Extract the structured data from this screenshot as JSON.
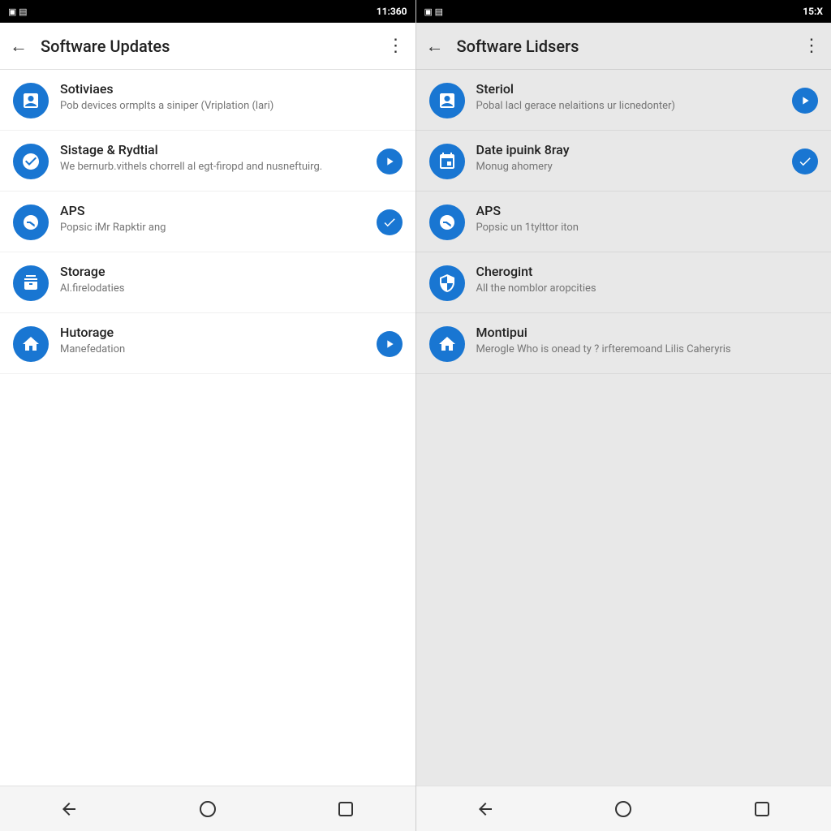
{
  "left_panel": {
    "status_bar": {
      "left_icons": "▣ ▤",
      "time": "11:360",
      "right_icons": "✦ ⊞ ▾ ▴ ▌▌"
    },
    "app_bar": {
      "title": "Software Updates",
      "back_icon": "←",
      "more_icon": "⋮"
    },
    "items": [
      {
        "id": "sotiviaes",
        "title": "Sotiviaes",
        "subtitle": "Pob devices ormplts a siniper (Vriplation (lari)",
        "has_action": false,
        "action_type": ""
      },
      {
        "id": "sistage-rydtial",
        "title": "Sistage & Rydtial",
        "subtitle": "We bernurb.vithels chorrell al egt-firopd and nusneftuirg.",
        "has_action": true,
        "action_type": "play"
      },
      {
        "id": "aps-left",
        "title": "APS",
        "subtitle": "Popsic iMr Rapktir ang",
        "has_action": true,
        "action_type": "check"
      },
      {
        "id": "storage-left",
        "title": "Storage",
        "subtitle": "Al.firelodaties",
        "has_action": false,
        "action_type": ""
      },
      {
        "id": "hutorage-left",
        "title": "Hutorage",
        "subtitle": "Manefedation",
        "has_action": true,
        "action_type": "play"
      }
    ]
  },
  "right_panel": {
    "status_bar": {
      "left_icons": "▣ ▤",
      "time": "15:X",
      "right_icons": "✦ ⊞ ▾ ▴ ▌▌"
    },
    "app_bar": {
      "title": "Software Lidsers",
      "back_icon": "←",
      "more_icon": "⋮"
    },
    "items": [
      {
        "id": "steriol",
        "title": "Steriol",
        "subtitle": "Pobal lacl gerace nelaitions ur licnedonter)",
        "has_action": true,
        "action_type": "play"
      },
      {
        "id": "date-ipuink-8ray",
        "title": "Date ipuink 8ray",
        "subtitle": "Monug ahomery",
        "has_action": true,
        "action_type": "check"
      },
      {
        "id": "aps-right",
        "title": "APS",
        "subtitle": "Popsic un 1tylttor iton",
        "has_action": false,
        "action_type": ""
      },
      {
        "id": "cherogint",
        "title": "Cherogint",
        "subtitle": "All the nomblor aropcities",
        "has_action": false,
        "action_type": ""
      },
      {
        "id": "montipui",
        "title": "Montipui",
        "subtitle": "Merogle Who is onead ty ? irfteremoand Lilis Caheryris",
        "has_action": false,
        "action_type": ""
      }
    ]
  },
  "nav": {
    "back": "back-icon",
    "home": "home-icon",
    "recents": "recents-icon"
  }
}
